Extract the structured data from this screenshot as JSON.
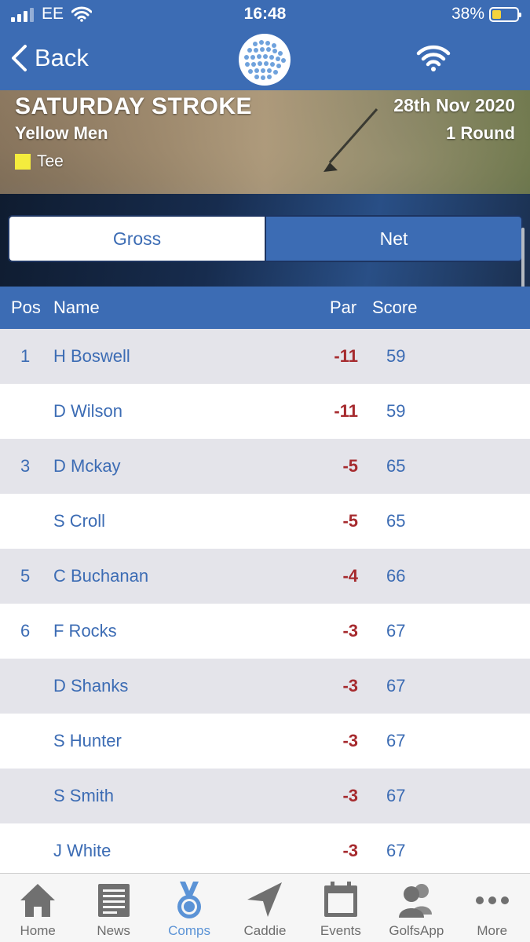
{
  "status_bar": {
    "carrier": "EE",
    "time": "16:48",
    "battery": "38%"
  },
  "nav": {
    "back_label": "Back"
  },
  "competition": {
    "title": "SATURDAY STROKE",
    "division": "Yellow Men",
    "tee_label": "Tee",
    "tee_color": "#f4ec3d",
    "date": "28th Nov 2020",
    "rounds": "1 Round"
  },
  "segment": {
    "gross_label": "Gross",
    "net_label": "Net",
    "selected": "Gross"
  },
  "table": {
    "headers": {
      "pos": "Pos",
      "name": "Name",
      "par": "Par",
      "score": "Score"
    },
    "rows": [
      {
        "pos": "1",
        "name": "H Boswell",
        "par": "-11",
        "score": "59"
      },
      {
        "pos": "",
        "name": "D Wilson",
        "par": "-11",
        "score": "59"
      },
      {
        "pos": "3",
        "name": "D Mckay",
        "par": "-5",
        "score": "65"
      },
      {
        "pos": "",
        "name": "S Croll",
        "par": "-5",
        "score": "65"
      },
      {
        "pos": "5",
        "name": "C Buchanan",
        "par": "-4",
        "score": "66"
      },
      {
        "pos": "6",
        "name": "F Rocks",
        "par": "-3",
        "score": "67"
      },
      {
        "pos": "",
        "name": "D Shanks",
        "par": "-3",
        "score": "67"
      },
      {
        "pos": "",
        "name": "S Hunter",
        "par": "-3",
        "score": "67"
      },
      {
        "pos": "",
        "name": "S Smith",
        "par": "-3",
        "score": "67"
      },
      {
        "pos": "",
        "name": "J White",
        "par": "-3",
        "score": "67"
      }
    ]
  },
  "tabs": [
    {
      "label": "Home",
      "icon": "home-icon"
    },
    {
      "label": "News",
      "icon": "news-icon"
    },
    {
      "label": "Comps",
      "icon": "medal-icon",
      "active": true
    },
    {
      "label": "Caddie",
      "icon": "navigation-arrow-icon"
    },
    {
      "label": "Events",
      "icon": "calendar-icon"
    },
    {
      "label": "GolfsApp",
      "icon": "people-icon"
    },
    {
      "label": "More",
      "icon": "more-dots-icon"
    }
  ],
  "colors": {
    "primary": "#3c6cb4",
    "negative_par": "#a62a2e",
    "tab_active": "#5b93d6"
  }
}
